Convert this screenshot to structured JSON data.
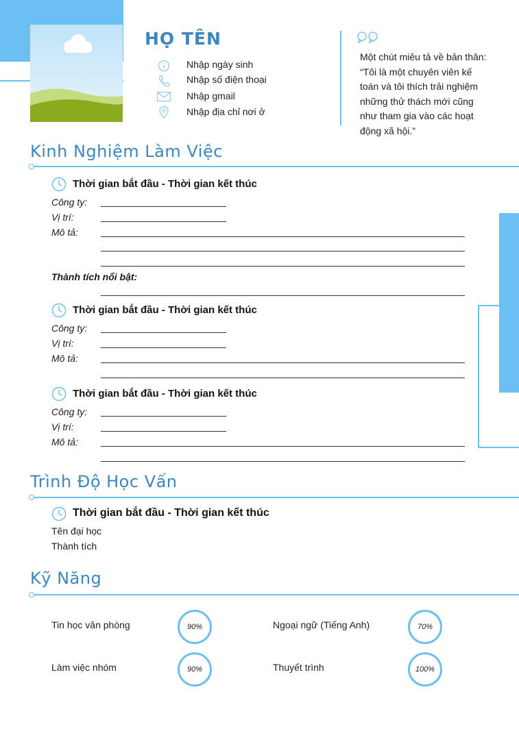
{
  "header": {
    "name": "HỌ TÊN",
    "contacts": [
      {
        "icon": "info-icon",
        "text": "Nhập ngày sinh"
      },
      {
        "icon": "phone-icon",
        "text": "Nhập số điện thoại"
      },
      {
        "icon": "mail-icon",
        "text": "Nhập gmail"
      },
      {
        "icon": "location-pin-icon",
        "text": "Nhập địa chỉ nơi ở"
      }
    ],
    "about_lines": [
      "Một chút miêu tả về bản thân:",
      "“Tôi là một chuyên viên kế",
      "toán và tôi thích trải nghiệm",
      "những thử thách mới cũng",
      "như tham gia vào các hoạt",
      "động xã hội.”"
    ]
  },
  "experience": {
    "title": "Kinh Nghiệm Làm Việc",
    "time_label": "Thời gian bắt đầu - Thời gian kết thúc",
    "company_label": "Công ty:",
    "position_label": "Vị trí:",
    "description_label": "Mô tả:",
    "achievement_label": "Thành tích nổi bật:"
  },
  "education": {
    "title": "Trình Độ Học Vấn",
    "time_label": "Thời gian bắt đầu - Thời gian kết thúc",
    "school": "Tên đại học",
    "achievement": "Thành tích"
  },
  "skills": {
    "title": "Kỹ Năng",
    "items": [
      {
        "name": "Tin học văn phòng",
        "level": "90%"
      },
      {
        "name": "Ngoại ngữ (Tiếng Anh)",
        "level": "70%"
      },
      {
        "name": "Làm việc nhóm",
        "level": "90%"
      },
      {
        "name": "Thuyết trình",
        "level": "100%"
      }
    ]
  },
  "colors": {
    "accent": "#6cbff2",
    "heading": "#3d86bf"
  }
}
